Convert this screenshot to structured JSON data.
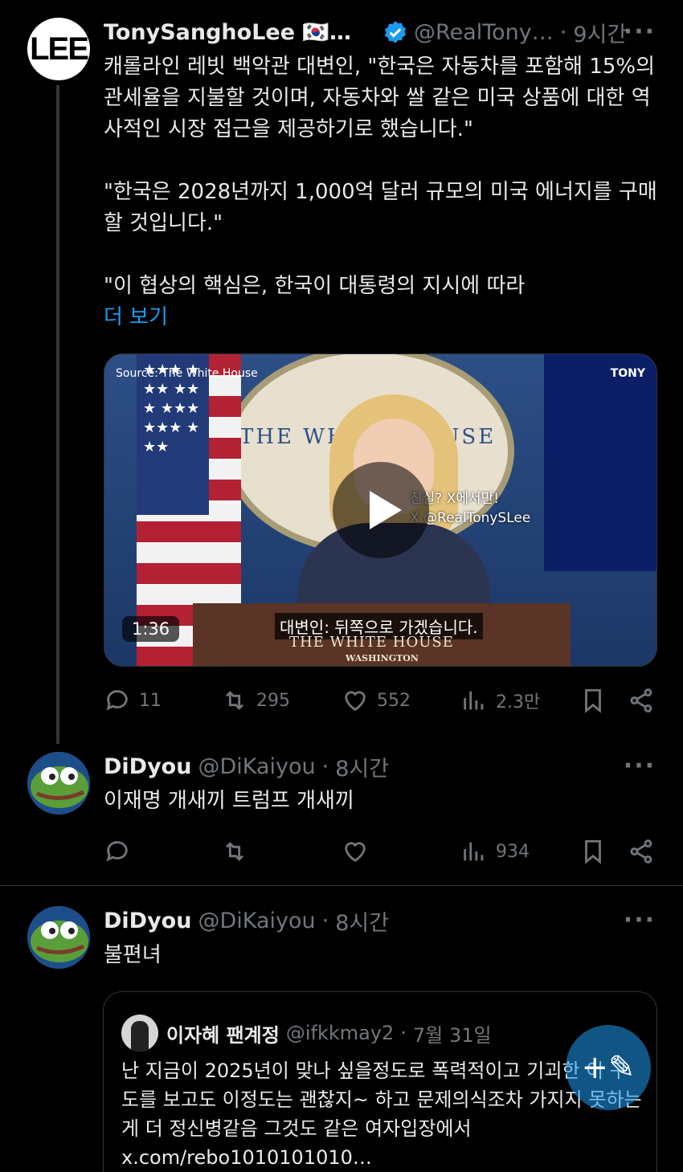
{
  "tweet1": {
    "avatar_text": "LEE",
    "name": "TonySanghoLee 🇰🇷…",
    "handle": "@RealTony…",
    "dot": "·",
    "time": "9시간",
    "more": "···",
    "text": "캐롤라인 레빗 백악관 대변인, \"한국은 자동차를 포함해 15%의 관세율을 지불할 것이며, 자동차와 쌀 같은 미국 상품에 대한 역사적인 시장 접근을 제공하기로 했습니다.\"\n\n\"한국은 2028년까지 1,000억 달러 규모의 미국 에너지를 구매할 것입니다.\"\n\n\"이 협상의 핵심은, 한국이 대통령의 지시에 따라",
    "show_more": "더 보기",
    "video": {
      "source": "Source: The White House",
      "brand": "TONY",
      "seal_text": "THE WHITE HOUSE",
      "watermark_line1": "진실? X에서만!",
      "watermark_line2": "X @RealTonySLee",
      "subtitle": "대변인: 뒤쪽으로 가겠습니다.",
      "house_text": "THE WHITE HOUSE",
      "wash_text": "WASHINGTON",
      "duration": "1:36"
    },
    "replies": "11",
    "reposts": "295",
    "likes": "552",
    "views": "2.3만"
  },
  "tweet2": {
    "name": "DiDyou",
    "handle": "@DiKaiyou",
    "dot": "·",
    "time": "8시간",
    "more": "···",
    "text": "이재명 개새끼 트럼프 개새끼",
    "views": "934"
  },
  "tweet3": {
    "name": "DiDyou",
    "handle": "@DiKaiyou",
    "dot": "·",
    "time": "8시간",
    "more": "···",
    "text": "불편녀",
    "quote": {
      "name": "이자혜 팬계정",
      "handle": "@ifkkmay2",
      "dot": "·",
      "time": "7월 31일",
      "text": "난 지금이 2025년이 맞나 싶을정도로 폭력적이고 기괴한 이 구도를 보고도 이정도는 괜찮지~ 하고 문제의식조차 가지지 못하는게 더 정신병같음 그것도 같은 여자입장에서 x.com/rebo1010101010…"
    }
  },
  "fab_icon": "compose-plus"
}
